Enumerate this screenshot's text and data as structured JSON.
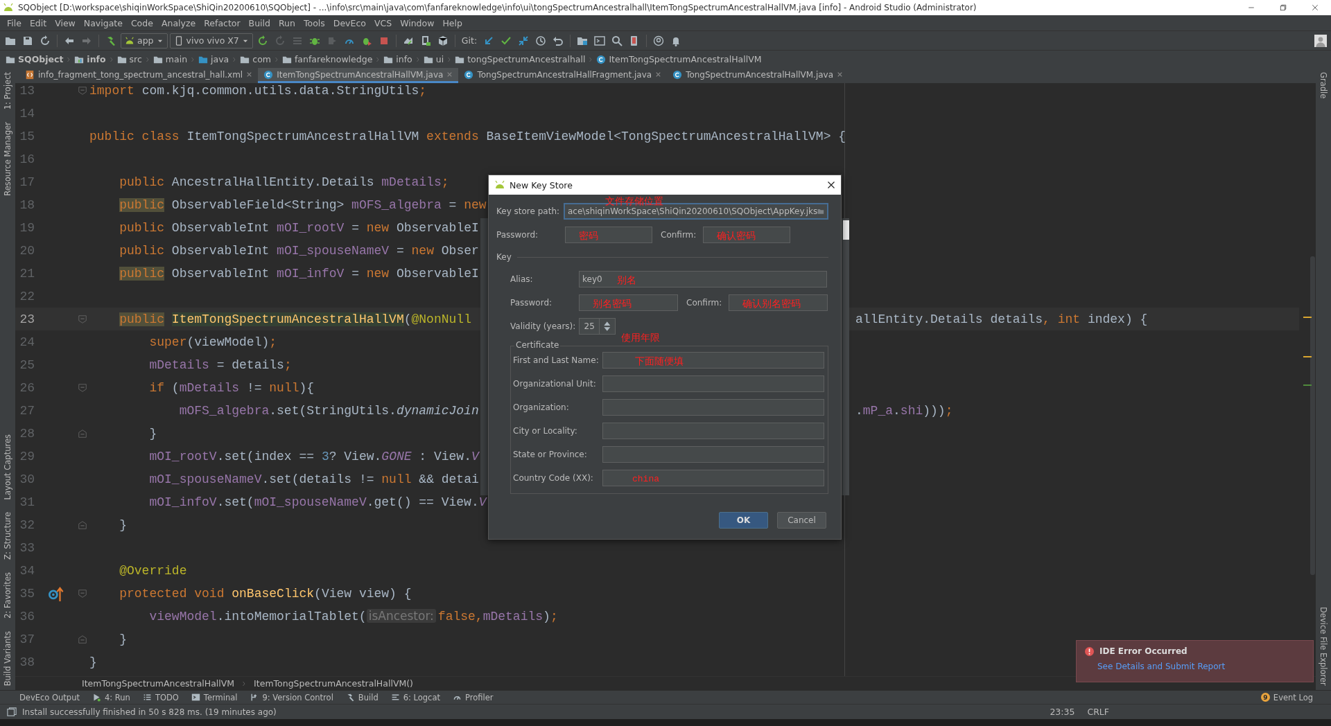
{
  "window": {
    "title": "SQObject [D:\\workspace\\shiqinWorkSpace\\ShiQin20200610\\SQObject] - ...\\info\\src\\main\\java\\com\\fanfareknowledge\\info\\ui\\tongSpectrumAncestralhall\\ItemTongSpectrumAncestralHallVM.java [info] - Android Studio (Administrator)"
  },
  "menu": [
    "File",
    "Edit",
    "View",
    "Navigate",
    "Code",
    "Analyze",
    "Refactor",
    "Build",
    "Run",
    "Tools",
    "DevEco",
    "VCS",
    "Window",
    "Help"
  ],
  "toolbar": {
    "run_config": "app",
    "device": "vivo vivo X7",
    "git_label": "Git:"
  },
  "breadcrumbs": [
    {
      "label": "SQObject",
      "bold": true
    },
    {
      "label": "info",
      "bold": true
    },
    {
      "label": "src",
      "bold": false
    },
    {
      "label": "main",
      "bold": false
    },
    {
      "label": "java",
      "bold": false
    },
    {
      "label": "com",
      "bold": false
    },
    {
      "label": "fanfareknowledge",
      "bold": false
    },
    {
      "label": "info",
      "bold": false
    },
    {
      "label": "ui",
      "bold": false
    },
    {
      "label": "tongSpectrumAncestralhall",
      "bold": false
    },
    {
      "label": "ItemTongSpectrumAncestralHallVM",
      "bold": false
    }
  ],
  "left_strip": {
    "top": [
      "1: Project",
      "Resource Manager"
    ],
    "bottom": [
      "Layout Captures",
      "Z: Structure",
      "2: Favorites",
      "Build Variants"
    ]
  },
  "right_strip": {
    "top": [
      "Gradle"
    ],
    "bottom": [
      "Device File Explorer"
    ]
  },
  "tabs": [
    {
      "label": "info_fragment_tong_spectrum_ancestral_hall.xml",
      "kind": "xml",
      "selected": false
    },
    {
      "label": "ItemTongSpectrumAncestralHallVM.java",
      "kind": "class",
      "selected": true
    },
    {
      "label": "TongSpectrumAncestralHallFragment.java",
      "kind": "class",
      "selected": false
    },
    {
      "label": "TongSpectrumAncestralHallVM.java",
      "kind": "class",
      "selected": false
    }
  ],
  "code_lines": [
    {
      "number": "13",
      "fold_start": true,
      "left": [
        {
          "kind": "kw",
          "text": "import"
        },
        {
          "kind": "plain",
          "text": " com.kjq.common.utils.data.StringUtils"
        },
        {
          "kind": "kw",
          "text": ";"
        }
      ]
    },
    {
      "number": "14"
    },
    {
      "number": "15",
      "left": [
        {
          "kind": "kw",
          "text": "public class "
        },
        {
          "kind": "plain",
          "text": "ItemTongSpectrumAncestralHallVM "
        },
        {
          "kind": "kw",
          "text": "extends "
        },
        {
          "kind": "plain",
          "text": "BaseItemViewModel<TongSpectrumAncestralHallVM> {"
        }
      ]
    },
    {
      "number": "16"
    },
    {
      "number": "17",
      "left": [
        {
          "kind": "kw",
          "text": "    public "
        },
        {
          "kind": "plain",
          "text": "AncestralHallEntity.Details "
        },
        {
          "kind": "field",
          "text": "mDetails"
        },
        {
          "kind": "kw",
          "text": ";"
        }
      ]
    },
    {
      "number": "18",
      "left": [
        {
          "kind": "kwmark",
          "text": "    public"
        },
        {
          "kind": "plain",
          "text": " ObservableField<String> "
        },
        {
          "kind": "field",
          "text": "mOFS_algebra"
        },
        {
          "kind": "plain",
          "text": " = "
        },
        {
          "kind": "kw",
          "text": "new"
        }
      ]
    },
    {
      "number": "19",
      "left": [
        {
          "kind": "kw",
          "text": "    public"
        },
        {
          "kind": "plain",
          "text": " ObservableInt "
        },
        {
          "kind": "field",
          "text": "mOI_rootV"
        },
        {
          "kind": "plain",
          "text": " = "
        },
        {
          "kind": "kw",
          "text": "new"
        },
        {
          "kind": "plain",
          "text": " ObservableI"
        }
      ]
    },
    {
      "number": "20",
      "left": [
        {
          "kind": "kw",
          "text": "    public"
        },
        {
          "kind": "plain",
          "text": " ObservableInt "
        },
        {
          "kind": "field",
          "text": "mOI_spouseNameV"
        },
        {
          "kind": "plain",
          "text": " = "
        },
        {
          "kind": "kw",
          "text": "new"
        },
        {
          "kind": "plain",
          "text": " Obser"
        }
      ]
    },
    {
      "number": "21",
      "left": [
        {
          "kind": "kwmark",
          "text": "    public"
        },
        {
          "kind": "plain",
          "text": " ObservableInt "
        },
        {
          "kind": "field",
          "text": "mOI_infoV"
        },
        {
          "kind": "plain",
          "text": " = "
        },
        {
          "kind": "kw",
          "text": "new"
        },
        {
          "kind": "plain",
          "text": " ObservableI"
        }
      ]
    },
    {
      "number": "22"
    },
    {
      "number": "23",
      "current": true,
      "fold_start": true,
      "left": [
        {
          "kind": "kwmark",
          "text": "    public "
        },
        {
          "kind": "declmark",
          "text": "ItemTongSpectrumAncestralHallVM"
        },
        {
          "kind": "plain",
          "text": "("
        },
        {
          "kind": "ann",
          "text": "@NonNull"
        }
      ],
      "right": [
        {
          "kind": "plain",
          "text": "allEntity.Details details"
        },
        {
          "kind": "kw",
          "text": ", int"
        },
        {
          "kind": "plain",
          "text": " index) {"
        }
      ]
    },
    {
      "number": "24",
      "left": [
        {
          "kind": "kw",
          "text": "        super"
        },
        {
          "kind": "plain",
          "text": "(viewModel)"
        },
        {
          "kind": "kw",
          "text": ";"
        }
      ]
    },
    {
      "number": "25",
      "left": [
        {
          "kind": "field",
          "text": "        mDetails"
        },
        {
          "kind": "plain",
          "text": " = details"
        },
        {
          "kind": "kw",
          "text": ";"
        }
      ]
    },
    {
      "number": "26",
      "fold_start": true,
      "left": [
        {
          "kind": "kw",
          "text": "        if"
        },
        {
          "kind": "plain",
          "text": " ("
        },
        {
          "kind": "field",
          "text": "mDetails"
        },
        {
          "kind": "plain",
          "text": " != "
        },
        {
          "kind": "kw",
          "text": "null"
        },
        {
          "kind": "plain",
          "text": "){"
        }
      ]
    },
    {
      "number": "27",
      "left": [
        {
          "kind": "field",
          "text": "            mOFS_algebra"
        },
        {
          "kind": "plain",
          "text": ".set(StringUtils."
        },
        {
          "kind": "italic",
          "text": "dynamicJoin"
        }
      ],
      "right": [
        {
          "kind": "plain",
          "text": "."
        },
        {
          "kind": "field",
          "text": "mP_a"
        },
        {
          "kind": "plain",
          "text": "."
        },
        {
          "kind": "field",
          "text": "shi"
        },
        {
          "kind": "plain",
          "text": ")))"
        },
        {
          "kind": "kw",
          "text": ";"
        }
      ]
    },
    {
      "number": "28",
      "fold_end": true,
      "left": [
        {
          "kind": "plain",
          "text": "        }"
        }
      ]
    },
    {
      "number": "29",
      "left": [
        {
          "kind": "field",
          "text": "        mOI_rootV"
        },
        {
          "kind": "plain",
          "text": ".set(index == "
        },
        {
          "kind": "num",
          "text": "3"
        },
        {
          "kind": "plain",
          "text": "? View."
        },
        {
          "kind": "static",
          "text": "GONE"
        },
        {
          "kind": "plain",
          "text": " : View."
        },
        {
          "kind": "static",
          "text": "V"
        }
      ]
    },
    {
      "number": "30",
      "left": [
        {
          "kind": "field",
          "text": "        mOI_spouseNameV"
        },
        {
          "kind": "plain",
          "text": ".set(details != "
        },
        {
          "kind": "kw",
          "text": "null"
        },
        {
          "kind": "plain",
          "text": " && detai"
        }
      ]
    },
    {
      "number": "31",
      "left": [
        {
          "kind": "field",
          "text": "        mOI_infoV"
        },
        {
          "kind": "plain",
          "text": ".set("
        },
        {
          "kind": "field",
          "text": "mOI_spouseNameV"
        },
        {
          "kind": "plain",
          "text": ".get() == View."
        },
        {
          "kind": "static",
          "text": "V"
        }
      ]
    },
    {
      "number": "32",
      "fold_end": true,
      "left": [
        {
          "kind": "plain",
          "text": "    }"
        }
      ]
    },
    {
      "number": "33"
    },
    {
      "number": "34",
      "left": [
        {
          "kind": "ann",
          "text": "    @Override"
        }
      ]
    },
    {
      "number": "35",
      "fold_start": true,
      "override_marker": true,
      "left": [
        {
          "kind": "kw",
          "text": "    protected void "
        },
        {
          "kind": "decl",
          "text": "onBaseClick"
        },
        {
          "kind": "plain",
          "text": "(View view) {"
        }
      ]
    },
    {
      "number": "36",
      "left": [
        {
          "kind": "field",
          "text": "        viewModel"
        },
        {
          "kind": "plain",
          "text": ".intoMemorialTablet("
        },
        {
          "kind": "hint",
          "text": "isAncestor:"
        },
        {
          "kind": "kw",
          "text": "false,"
        },
        {
          "kind": "field",
          "text": "mDetails"
        },
        {
          "kind": "plain",
          "text": ")"
        },
        {
          "kind": "kw",
          "text": ";"
        }
      ]
    },
    {
      "number": "37",
      "fold_end": true,
      "left": [
        {
          "kind": "plain",
          "text": "    }"
        }
      ]
    },
    {
      "number": "38",
      "left": [
        {
          "kind": "plain",
          "text": "}"
        }
      ]
    }
  ],
  "editor_breadcrumbs": [
    "ItemTongSpectrumAncestralHallVM",
    "ItemTongSpectrumAncestralHallVM()"
  ],
  "dialog": {
    "title": "New Key Store",
    "path": {
      "label": "Key store path:",
      "value": "ace\\shiqinWorkSpace\\ShiQin20200610\\SQObject\\AppKey.jks",
      "note": "文件存储位置"
    },
    "password_row": [
      {
        "label": "Password:",
        "note": "密码"
      },
      {
        "label": "Confirm:",
        "note": "确认密码"
      }
    ],
    "key_section": {
      "title": "Key",
      "alias": {
        "label": "Alias:",
        "value": "key0",
        "note": "别名"
      },
      "password_row": [
        {
          "label": "Password:",
          "note": "别名密码"
        },
        {
          "label": "Confirm:",
          "note": "确认别名密码"
        }
      ],
      "validity": {
        "label": "Validity (years):",
        "value": "25",
        "note": "使用年限"
      },
      "certificate": {
        "title": "Certificate",
        "fields": [
          {
            "label": "First and Last Name:",
            "note": "下面随便填"
          },
          {
            "label": "Organizational Unit:"
          },
          {
            "label": "Organization:"
          },
          {
            "label": "City or Locality:"
          },
          {
            "label": "State or Province:"
          },
          {
            "label": "Country Code (XX):",
            "note": "china",
            "kind": "mono"
          }
        ]
      }
    },
    "buttons": [
      {
        "label": "OK",
        "kind": "primary"
      },
      {
        "label": "Cancel",
        "kind": "secondary"
      }
    ]
  },
  "notification": {
    "title": "IDE Error Occurred",
    "link": "See Details and Submit Report"
  },
  "tool_windows": [
    {
      "label": "DevEco Output",
      "kind": "none"
    },
    {
      "label": "4: Run",
      "kind": "run"
    },
    {
      "label": "TODO",
      "kind": "todo"
    },
    {
      "label": "Terminal",
      "kind": "terminal"
    },
    {
      "label": "9: Version Control",
      "kind": "vcs"
    },
    {
      "label": "Build",
      "kind": "build"
    },
    {
      "label": "6: Logcat",
      "kind": "logcat"
    },
    {
      "label": "Profiler",
      "kind": "profiler"
    }
  ],
  "event_log": {
    "label": "Event Log",
    "count": "9"
  },
  "status_bar": {
    "message": "Install successfully finished in 50 s 828 ms. (19 minutes ago)",
    "position": "23:35",
    "line_separator": "CRLF"
  }
}
